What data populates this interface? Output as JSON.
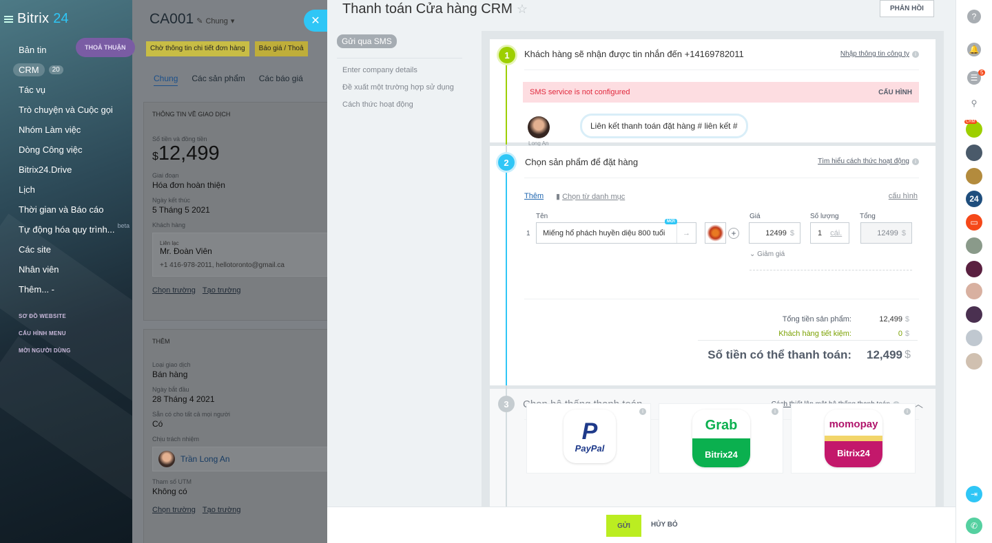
{
  "sidebar": {
    "brand": "Bitrix",
    "brand_num": "24",
    "items": [
      "Bản tin",
      "CRM",
      "Tác vụ",
      "Trò chuyện và Cuộc gọi",
      "Nhóm Làm việc",
      "Dòng Công việc",
      "Bitrix24.Drive",
      "Lịch",
      "Thời gian và Báo cáo",
      "Tự động hóa quy trình...",
      "Các site",
      "Nhân viên",
      "Thêm... -"
    ],
    "crm_counter": "20",
    "beta": "beta",
    "small_items": [
      "SƠ ĐỒ WEBSITE",
      "CẤU HÌNH MENU",
      "MỜI NGƯỜI DÙNG"
    ]
  },
  "deal": {
    "title": "CA001",
    "category": "Chung",
    "badge": "THOẢ THUẬN",
    "stage1": "Chờ thông tin chi tiết đơn hàng",
    "stage2": "Báo giá / Thoả",
    "tabs": [
      "Chung",
      "Các sản phẩm",
      "Các báo giá"
    ],
    "card1_title": "THÔNG TIN VỀ GIAO DỊCH",
    "amount_label": "Số tiền và đồng tiền",
    "currency": "$",
    "amount": "12,499",
    "stage_label": "Giai đoạn",
    "stage_value": "Hóa đơn hoàn thiện",
    "close_label": "Ngày kết thúc",
    "close_value": "5 Tháng 5 2021",
    "client_label": "Khách hàng",
    "contact_label": "Liên lạc",
    "contact_name": "Mr. Đoàn Viên",
    "contact_info": "+1 416-978-2011, hellotoronto@gmail.ca",
    "link_select": "Chọn trường",
    "link_create": "Tạo trường",
    "card2_title": "THÊM",
    "type_label": "Loại giao dịch",
    "type_value": "Bán hàng",
    "start_label": "Ngày bắt đầu",
    "start_value": "28 Tháng 4 2021",
    "avail_label": "Sẵn có cho tất cả mọi người",
    "avail_value": "Có",
    "resp_label": "Chịu trách nhiệm",
    "resp_name": "Trần Long An",
    "utm_label": "Tham số UTM",
    "utm_value": "Không có"
  },
  "slider": {
    "title": "Thanh toán Cửa hàng CRM",
    "feedback": "PHẢN HỒI",
    "sms_tag": "Gửi qua SMS",
    "left_nav": [
      "Enter company details",
      "Đề xuất một trường hợp sử dụng",
      "Cách thức hoạt động"
    ],
    "step1": {
      "num": "1",
      "title": "Khách hàng sẽ nhận được tin nhắn đến +14169782011",
      "link": "Nhập thông tin công ty",
      "alert": "SMS service is not configured",
      "alert_action": "CẤU HÌNH",
      "sender": "Long An",
      "message": "Liên kết thanh toán đặt hàng # liên kết #"
    },
    "step2": {
      "num": "2",
      "title": "Chọn sản phẩm để đặt hàng",
      "link": "Tìm hiểu cách thức hoạt động",
      "add": "Thêm",
      "catalog": "Chọn từ danh mục",
      "config": "cấu hình",
      "col_name": "Tên",
      "col_price": "Giá",
      "col_qty": "Số lượng",
      "col_total": "Tổng",
      "new_badge": "MỚI",
      "row_num": "1",
      "product": "Miếng hổ phách huyền diệu 800 tuổi",
      "price": "12499",
      "qty": "1",
      "unit": "cái.",
      "total": "12499",
      "currency": "$",
      "discount": "Giảm giá",
      "subtotal_label": "Tổng tiền sản phẩm:",
      "subtotal": "12,499",
      "saved_label": "Khách hàng tiết kiệm:",
      "saved": "0",
      "payable_label": "Số tiền có thể thanh toán:",
      "payable": "12,499"
    },
    "step3": {
      "num": "3",
      "title": "Chọn hệ thống thanh toán",
      "link": "Cách thiết lập một hệ thống thanh toán",
      "paypal": "PayPal",
      "grab": "Grab",
      "momo": "momopay",
      "bitrix": "Bitrix24"
    },
    "send": "GỬI",
    "cancel": "HỦY BỎ"
  },
  "rightbar": {
    "notif_count": "5",
    "crm_label": "CRM",
    "b24": "24"
  },
  "colors": {
    "accent_blue": "#2fc6f6",
    "step_green": "#9dcf00",
    "send_green": "#bbed21",
    "alert_bg": "#fddde1"
  }
}
